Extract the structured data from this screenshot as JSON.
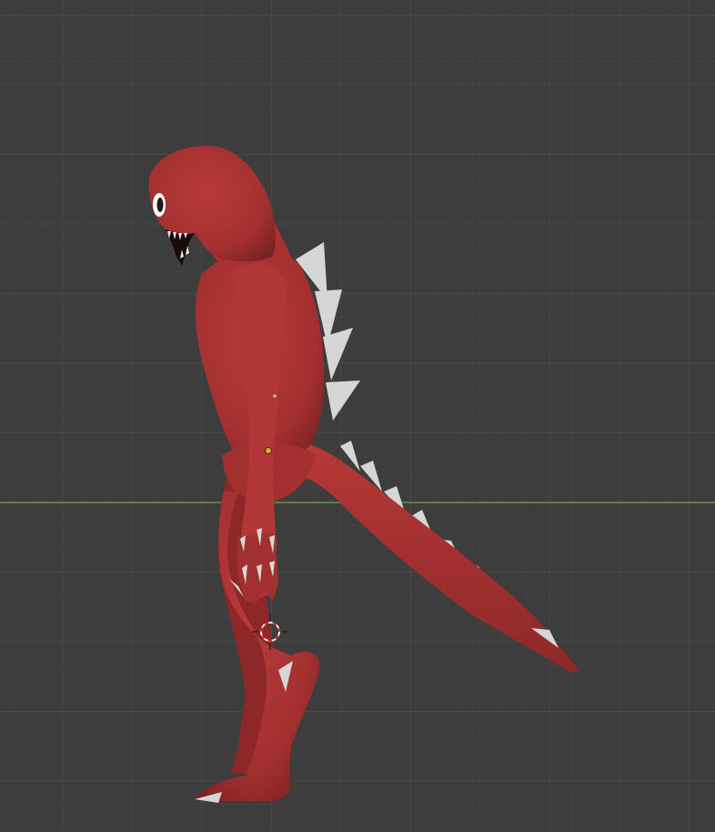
{
  "viewport": {
    "view": "right-orthographic",
    "background_color": "#3d3d3d",
    "grid_minor_color": "#444444",
    "grid_major_color": "#4b4b4b",
    "horizon_axis_color": "#6b8e3a",
    "axis_name": "y-axis"
  },
  "model": {
    "name": "red-creature",
    "body_color": "#a93232",
    "spike_color": "#d9d9d9",
    "eye_color": "#ffffff",
    "mouth_color": "#1a0a0a"
  },
  "overlays": {
    "object_origin_color": "#f2a43c",
    "cursor_3d_color": "#ffffff",
    "cursor_3d_accent": "#d23a3a"
  }
}
